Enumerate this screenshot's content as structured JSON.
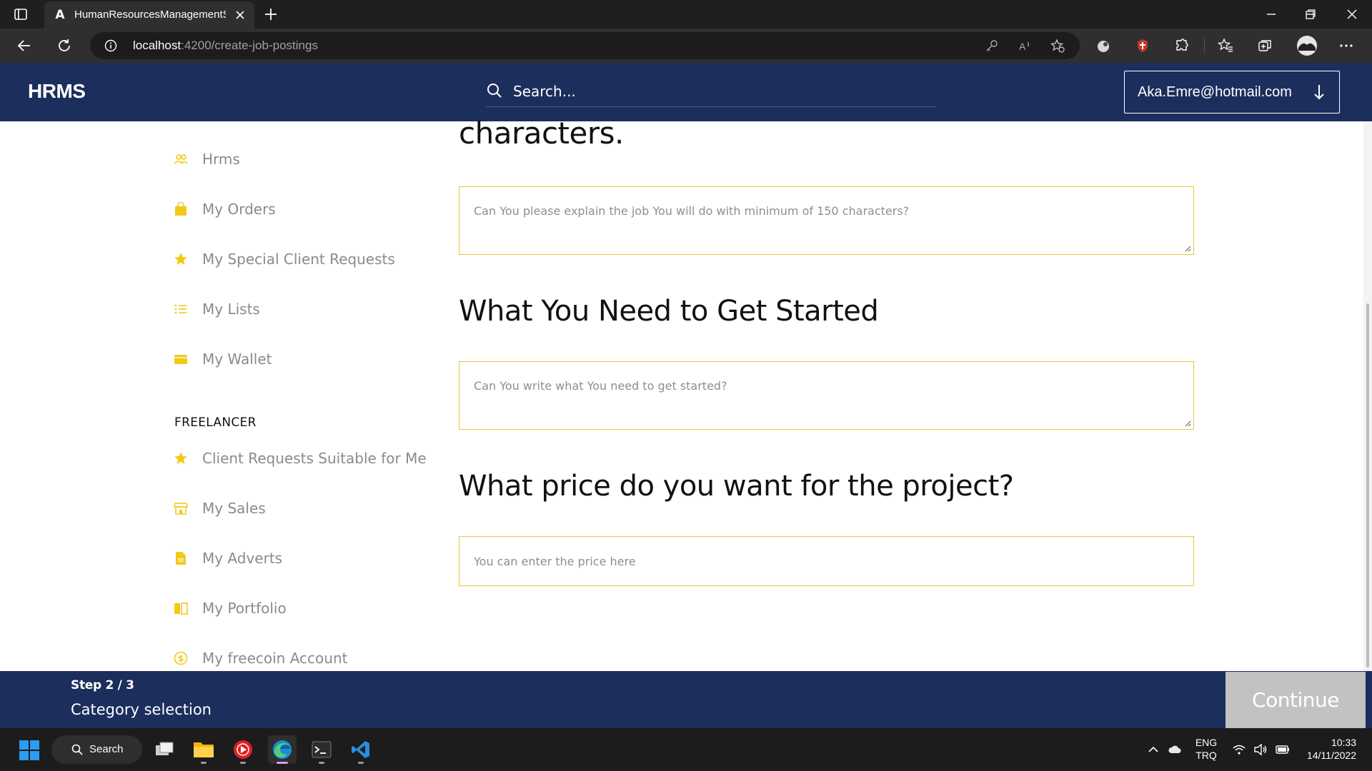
{
  "browser": {
    "tab_title": "HumanResourcesManagementSy",
    "tab_favicon": "A",
    "url_host": "localhost",
    "url_path": ":4200/create-job-postings"
  },
  "header": {
    "brand": "HRMS",
    "search_placeholder": "Search...",
    "user_email": "Aka.Emre@hotmail.com"
  },
  "sidebar": {
    "items": [
      {
        "label": "Hrms",
        "icon": "users-icon"
      },
      {
        "label": "My Orders",
        "icon": "shopping-bag-icon"
      },
      {
        "label": "My Special Client Requests",
        "icon": "star-icon"
      },
      {
        "label": "My Lists",
        "icon": "list-icon"
      },
      {
        "label": "My Wallet",
        "icon": "wallet-icon"
      }
    ],
    "section_title": "FREELANCER",
    "freelancer_items": [
      {
        "label": "Client Requests Suitable for Me",
        "icon": "star-icon"
      },
      {
        "label": "My Sales",
        "icon": "store-icon"
      },
      {
        "label": "My Adverts",
        "icon": "document-icon"
      },
      {
        "label": "My Portfolio",
        "icon": "book-icon"
      },
      {
        "label": "My freecoin Account",
        "icon": "coin-icon"
      }
    ]
  },
  "form": {
    "cut_heading": "characters.",
    "description_placeholder": "Can You please explain the job You will do with minimum of 150 characters?",
    "requirements_heading": "What You Need to Get Started",
    "requirements_placeholder": "Can You write what You need to get started?",
    "price_heading": "What price do you want for the project?",
    "price_placeholder": "You can enter the price here"
  },
  "footer": {
    "step": "Step 2 / 3",
    "step_name": "Category selection",
    "continue_label": "Continue"
  },
  "taskbar": {
    "search_label": "Search",
    "lang_top": "ENG",
    "lang_bottom": "TRQ",
    "time": "10:33",
    "date": "14/11/2022"
  },
  "colors": {
    "brand_navy": "#1c2e5c",
    "accent_yellow": "#f2c916",
    "field_border": "#e6c83a",
    "continue_disabled": "#c2c2c2"
  }
}
